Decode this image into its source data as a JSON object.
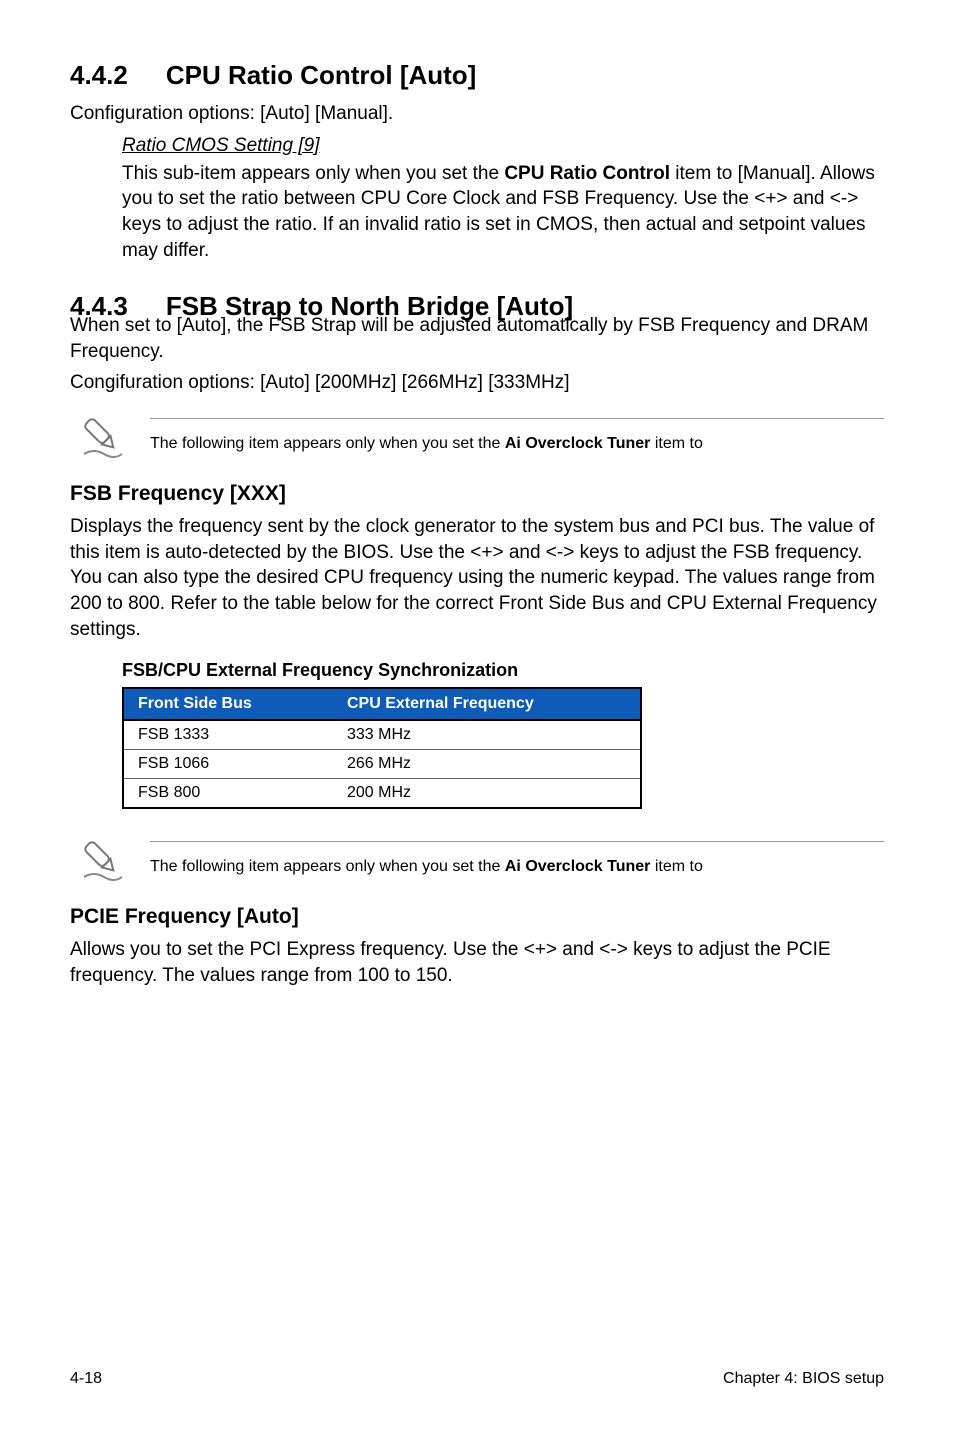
{
  "section442": {
    "number": "4.4.2",
    "title": "CPU Ratio Control [Auto]",
    "intro": "Configuration options: [Auto] [Manual].",
    "sub_heading": "Ratio CMOS Setting [9]",
    "sub_body_before_bold": "This sub-item appears only when you set the ",
    "sub_body_bold": "CPU Ratio Control",
    "sub_body_after_bold": " item to [Manual]. Allows you to set the ratio between CPU Core Clock and FSB Frequency. Use the <+> and <-> keys to adjust the ratio. If an invalid ratio is set in CMOS, then actual and setpoint values may differ."
  },
  "section443": {
    "number": "4.4.3",
    "title": "FSB Strap to North Bridge [Auto]",
    "body1": "When set to [Auto], the FSB Strap will be adjusted automatically by FSB Frequency and DRAM Frequency.",
    "body2": "Congifuration options: [Auto] [200MHz] [266MHz] [333MHz]"
  },
  "note1": {
    "text_before": "The following item appears only when you set the ",
    "bold": "Ai Overclock Tuner",
    "text_after": " item to"
  },
  "fsb_freq": {
    "heading": "FSB Frequency [XXX]",
    "body": "Displays the frequency sent by the clock generator to the system bus and PCI bus. The value of this item is auto-detected by the BIOS. Use the <+> and <-> keys to adjust the FSB frequency. You can also type the desired CPU frequency using the numeric keypad. The values range from 200 to 800. Refer to the table below for the correct Front Side Bus and CPU External Frequency settings."
  },
  "table": {
    "caption": "FSB/CPU External Frequency Synchronization",
    "head_col1": "Front Side Bus",
    "head_col2": "CPU External Frequency",
    "rows": [
      {
        "c1": "FSB 1333",
        "c2": "333 MHz"
      },
      {
        "c1": "FSB 1066",
        "c2": "266 MHz"
      },
      {
        "c1": "FSB 800",
        "c2": "200 MHz"
      }
    ]
  },
  "note2": {
    "text_before": "The following item appears only when you set the ",
    "bold": "Ai Overclock Tuner",
    "text_after": " item to"
  },
  "pcie": {
    "heading": "PCIE Frequency [Auto]",
    "body": "Allows you to set the PCI Express frequency. Use the <+> and <-> keys to adjust the PCIE frequency. The values range from 100 to 150."
  },
  "footer": {
    "left": "4-18",
    "right": "Chapter 4: BIOS setup"
  }
}
